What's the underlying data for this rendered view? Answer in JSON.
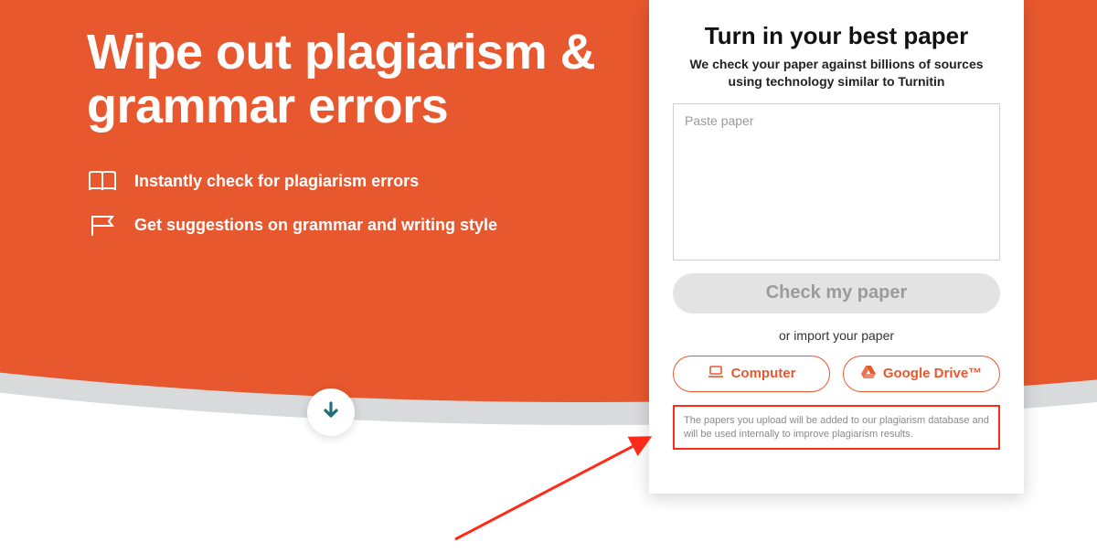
{
  "colors": {
    "accent": "#e8582e",
    "annotation": "#ff2b1a",
    "arrowTeal": "#1f6e7a"
  },
  "hero": {
    "headline": "Wipe out plagiarism & grammar errors",
    "features": [
      "Instantly check for plagiarism errors",
      "Get suggestions on grammar and writing style"
    ]
  },
  "card": {
    "title": "Turn in your best paper",
    "subtitle": "We check your paper against billions of sources using technology similar to Turnitin",
    "paste_placeholder": "Paste paper",
    "check_label": "Check my paper",
    "or_text": "or import your paper",
    "import_computer": "Computer",
    "import_gdrive": "Google Drive™",
    "disclaimer": "The papers you upload will be added to our plagiarism database and will be used internally to improve plagiarism results."
  }
}
